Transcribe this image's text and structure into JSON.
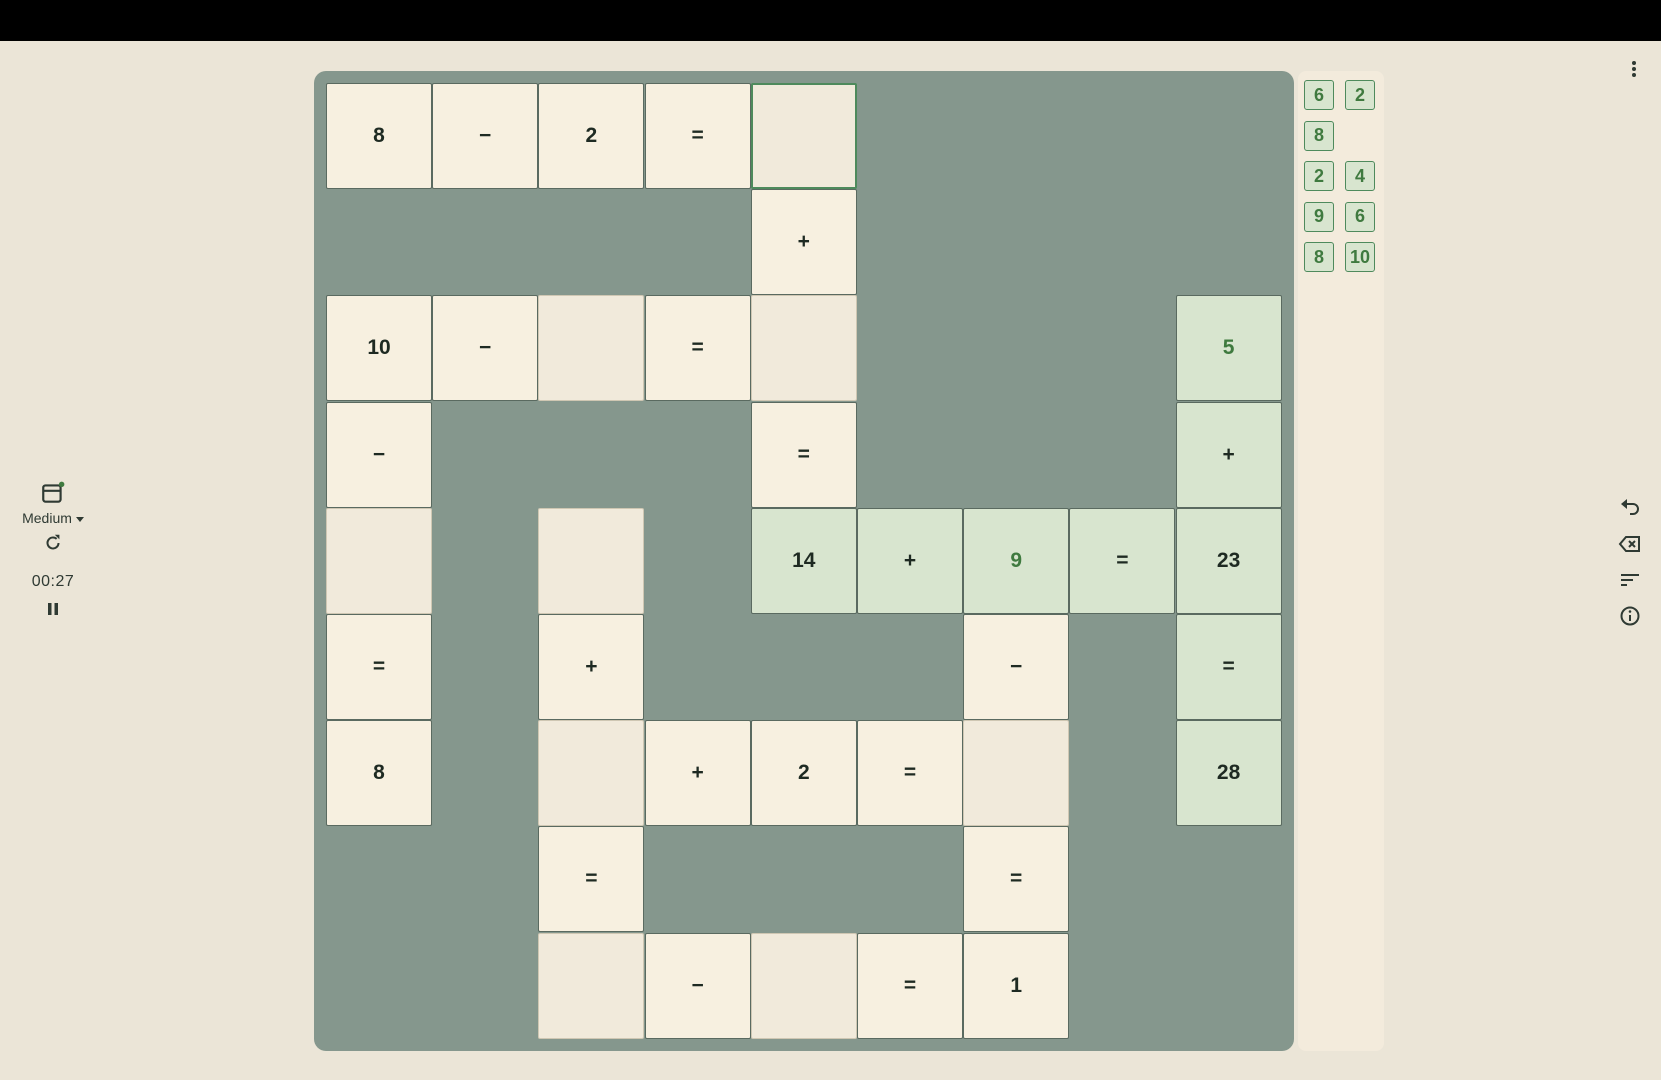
{
  "controls": {
    "difficulty": "Medium",
    "timer": "00:27"
  },
  "board": {
    "cells": [
      {
        "r": 0,
        "c": 0,
        "v": "8"
      },
      {
        "r": 0,
        "c": 1,
        "v": "−"
      },
      {
        "r": 0,
        "c": 2,
        "v": "2"
      },
      {
        "r": 0,
        "c": 3,
        "v": "="
      },
      {
        "r": 0,
        "c": 4,
        "v": "",
        "empty": true,
        "selected": true
      },
      {
        "r": 1,
        "c": 4,
        "v": "+"
      },
      {
        "r": 2,
        "c": 0,
        "v": "10"
      },
      {
        "r": 2,
        "c": 1,
        "v": "−"
      },
      {
        "r": 2,
        "c": 2,
        "v": "",
        "empty": true
      },
      {
        "r": 2,
        "c": 3,
        "v": "="
      },
      {
        "r": 2,
        "c": 4,
        "v": "",
        "empty": true
      },
      {
        "r": 2,
        "c": 8,
        "v": "5",
        "solved": true,
        "hl": true
      },
      {
        "r": 3,
        "c": 0,
        "v": "−"
      },
      {
        "r": 3,
        "c": 4,
        "v": "="
      },
      {
        "r": 3,
        "c": 8,
        "v": "+",
        "solved": true
      },
      {
        "r": 4,
        "c": 0,
        "v": "",
        "empty": true
      },
      {
        "r": 4,
        "c": 2,
        "v": "",
        "empty": true
      },
      {
        "r": 4,
        "c": 4,
        "v": "14",
        "solved": true
      },
      {
        "r": 4,
        "c": 5,
        "v": "+",
        "solved": true
      },
      {
        "r": 4,
        "c": 6,
        "v": "9",
        "solved": true,
        "hl": true
      },
      {
        "r": 4,
        "c": 7,
        "v": "=",
        "solved": true
      },
      {
        "r": 4,
        "c": 8,
        "v": "23",
        "solved": true
      },
      {
        "r": 5,
        "c": 0,
        "v": "="
      },
      {
        "r": 5,
        "c": 2,
        "v": "+"
      },
      {
        "r": 5,
        "c": 6,
        "v": "−"
      },
      {
        "r": 5,
        "c": 8,
        "v": "=",
        "solved": true
      },
      {
        "r": 6,
        "c": 0,
        "v": "8"
      },
      {
        "r": 6,
        "c": 2,
        "v": "",
        "empty": true
      },
      {
        "r": 6,
        "c": 3,
        "v": "+"
      },
      {
        "r": 6,
        "c": 4,
        "v": "2"
      },
      {
        "r": 6,
        "c": 5,
        "v": "="
      },
      {
        "r": 6,
        "c": 6,
        "v": "",
        "empty": true
      },
      {
        "r": 6,
        "c": 8,
        "v": "28",
        "solved": true
      },
      {
        "r": 7,
        "c": 2,
        "v": "="
      },
      {
        "r": 7,
        "c": 6,
        "v": "="
      },
      {
        "r": 8,
        "c": 2,
        "v": "",
        "empty": true
      },
      {
        "r": 8,
        "c": 3,
        "v": "−"
      },
      {
        "r": 8,
        "c": 4,
        "v": "",
        "empty": true
      },
      {
        "r": 8,
        "c": 5,
        "v": "="
      },
      {
        "r": 8,
        "c": 6,
        "v": "1"
      }
    ]
  },
  "tray": {
    "tiles": [
      {
        "row": 0,
        "col": 0,
        "v": "6"
      },
      {
        "row": 0,
        "col": 1,
        "v": "2"
      },
      {
        "row": 1,
        "col": 0,
        "v": "8"
      },
      {
        "row": 2,
        "col": 0,
        "v": "2"
      },
      {
        "row": 2,
        "col": 1,
        "v": "4"
      },
      {
        "row": 3,
        "col": 0,
        "v": "9"
      },
      {
        "row": 3,
        "col": 1,
        "v": "6"
      },
      {
        "row": 4,
        "col": 0,
        "v": "8"
      },
      {
        "row": 4,
        "col": 1,
        "v": "10"
      }
    ]
  },
  "icons": {
    "calendar": "calendar-icon",
    "refresh": "refresh-icon",
    "pause": "pause-icon",
    "undo": "undo-icon",
    "backspace": "backspace-icon",
    "sort": "sort-icon",
    "info": "info-icon",
    "more": "more-vert-icon"
  }
}
